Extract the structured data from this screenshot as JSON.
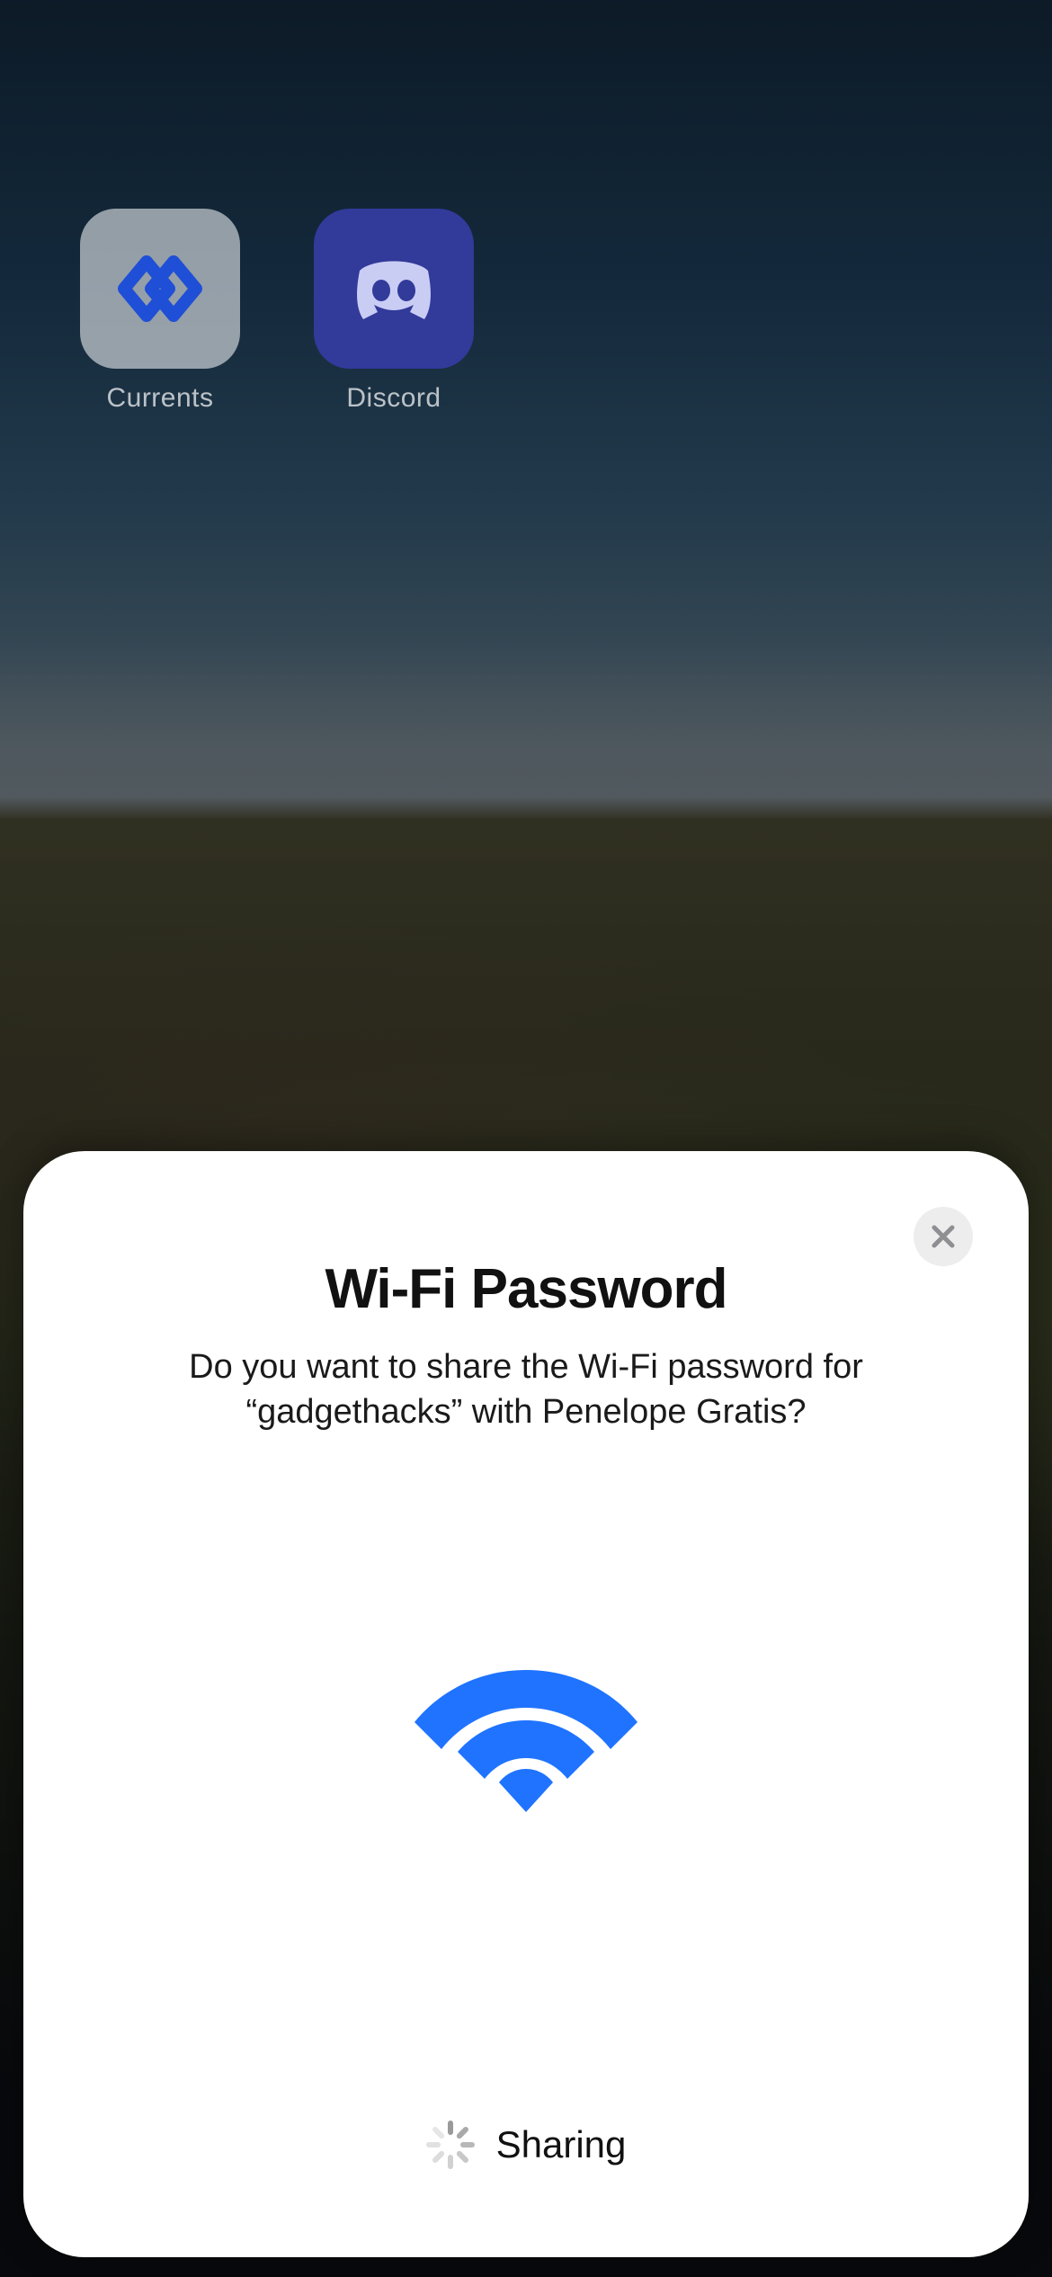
{
  "home_screen": {
    "apps": [
      {
        "label": "Currents",
        "icon": "currents-icon"
      },
      {
        "label": "Discord",
        "icon": "discord-icon"
      }
    ]
  },
  "sheet": {
    "title": "Wi-Fi Password",
    "subtitle": "Do you want to share the Wi-Fi password for “gadgethacks” with Penelope Gratis?",
    "network_name": "gadgethacks",
    "recipient_name": "Penelope Gratis",
    "close_icon": "close-icon",
    "graphic_icon": "wifi-icon",
    "status": {
      "label": "Sharing",
      "spinner_icon": "spinner-icon",
      "in_progress": true
    }
  },
  "colors": {
    "accent_blue": "#1f73ff",
    "sheet_bg": "#ffffff",
    "close_bg": "#ededed",
    "close_x": "#8e8e93"
  }
}
